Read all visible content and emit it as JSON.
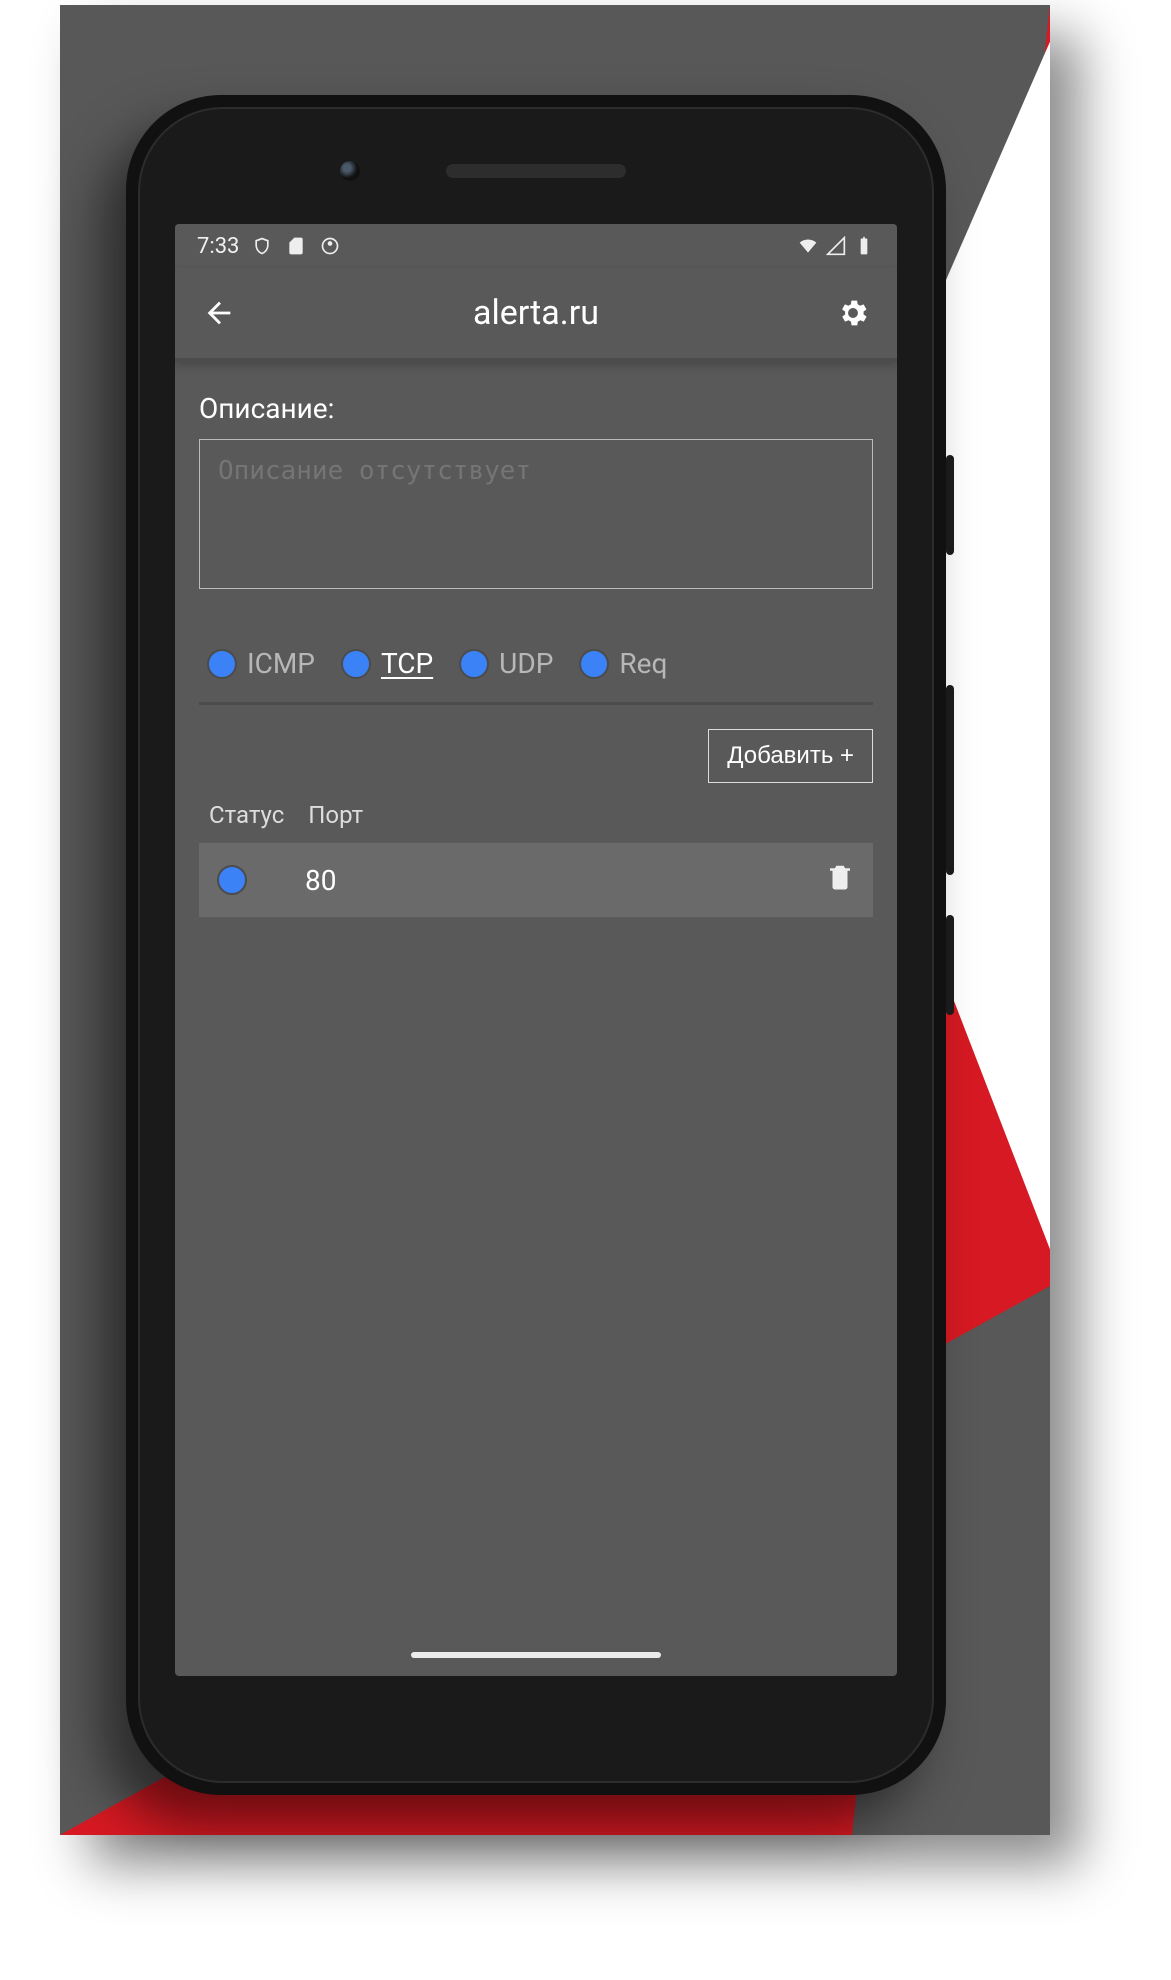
{
  "status_bar": {
    "time": "7:33"
  },
  "header": {
    "title": "alerta.ru"
  },
  "description": {
    "label": "Описание:",
    "placeholder": "Описание отсутствует",
    "value": ""
  },
  "tabs": [
    {
      "label": "ICMP",
      "active": false
    },
    {
      "label": "TCP",
      "active": true
    },
    {
      "label": "UDP",
      "active": false
    },
    {
      "label": "Req",
      "active": false
    }
  ],
  "add_button": "Добавить +",
  "columns": {
    "status": "Статус",
    "port": "Порт"
  },
  "rows": [
    {
      "port": "80"
    }
  ]
}
